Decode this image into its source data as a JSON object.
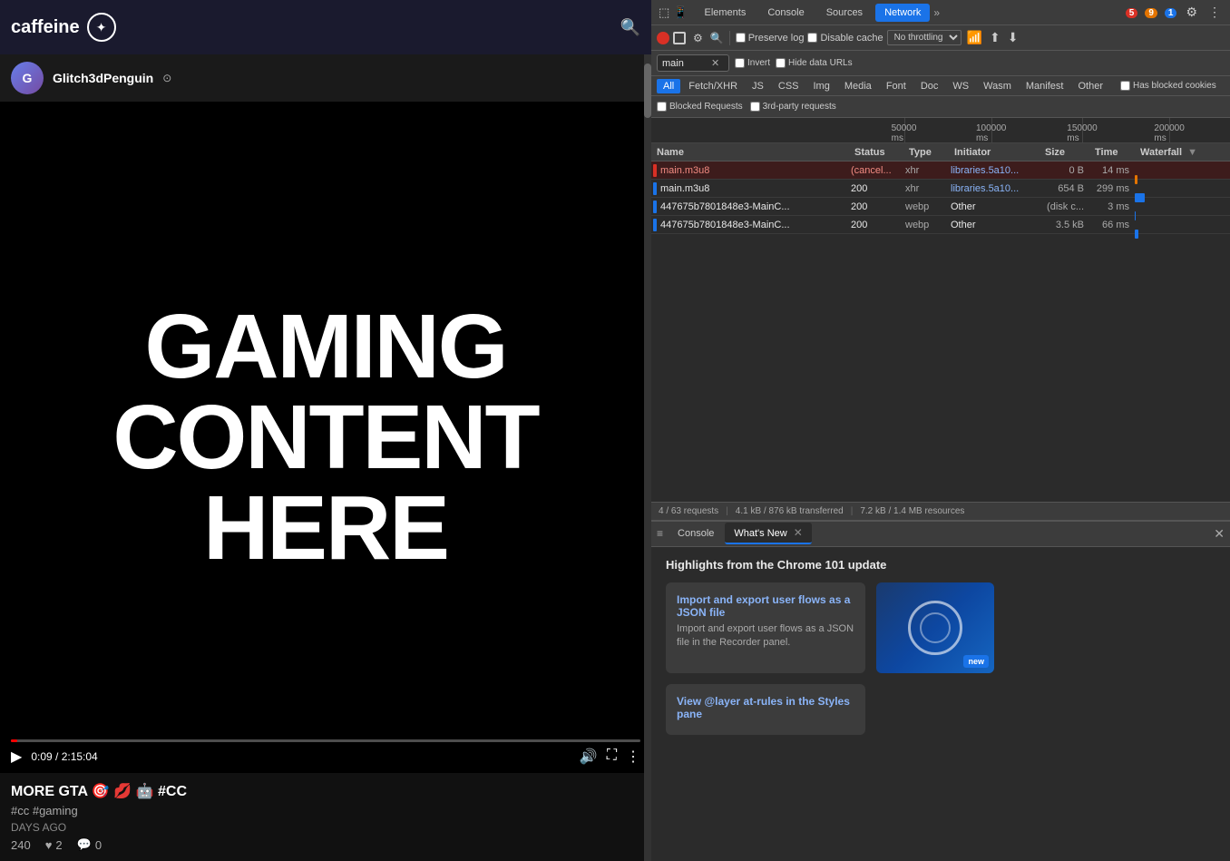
{
  "browser": {
    "logo_text": "caffeine",
    "logo_icon": "☆"
  },
  "video": {
    "title_line1": "GAMING",
    "title_line2": "CONTENT",
    "title_line3": "HERE",
    "current_time": "0:09",
    "total_time": "2:15:04",
    "progress_percent": 0.07,
    "channel_name": "Glitch3dPenguin",
    "video_title": "MORE GTA 🎯 💋 🤖 #CC",
    "video_tags": "#cc  #gaming",
    "days_ago": "DAYS AGO",
    "views": "240",
    "likes": "2",
    "comments": "0"
  },
  "devtools": {
    "tabs": [
      {
        "label": "Elements",
        "active": false
      },
      {
        "label": "Console",
        "active": false
      },
      {
        "label": "Sources",
        "active": false
      },
      {
        "label": "Network",
        "active": true
      }
    ],
    "error_count": "5",
    "warn_count": "9",
    "info_count": "1",
    "toolbar": {
      "record_btn": "record",
      "clear_btn": "clear",
      "filter_icon": "filter",
      "search_icon": "search",
      "preserve_log_label": "Preserve log",
      "preserve_log_checked": false,
      "disable_cache_label": "Disable cache",
      "disable_cache_checked": false,
      "throttle_value": "No throttling",
      "export_icon": "export",
      "import_icon": "import"
    },
    "filter_bar": {
      "input_value": "main",
      "invert_label": "Invert",
      "invert_checked": false,
      "hide_data_urls_label": "Hide data URLs",
      "hide_data_urls_checked": false
    },
    "filter_tabs": [
      {
        "label": "All",
        "active": true
      },
      {
        "label": "Fetch/XHR",
        "active": false
      },
      {
        "label": "JS",
        "active": false
      },
      {
        "label": "CSS",
        "active": false
      },
      {
        "label": "Img",
        "active": false
      },
      {
        "label": "Media",
        "active": false
      },
      {
        "label": "Font",
        "active": false
      },
      {
        "label": "Doc",
        "active": false
      },
      {
        "label": "WS",
        "active": false
      },
      {
        "label": "Wasm",
        "active": false
      },
      {
        "label": "Manifest",
        "active": false
      },
      {
        "label": "Other",
        "active": false
      }
    ],
    "has_blocked_cookies_label": "Has blocked cookies",
    "has_blocked_cookies_checked": false,
    "blocked_requests_label": "Blocked Requests",
    "blocked_requests_checked": false,
    "third_party_label": "3rd-party requests",
    "third_party_checked": false,
    "timeline": {
      "ticks": [
        {
          "ms": "50000 ms",
          "pos_pct": 14
        },
        {
          "ms": "100000 ms",
          "pos_pct": 37
        },
        {
          "ms": "150000 ms",
          "pos_pct": 61
        },
        {
          "ms": "200000 ms",
          "pos_pct": 84
        }
      ]
    },
    "table_headers": {
      "name": "Name",
      "status": "Status",
      "type": "Type",
      "initiator": "Initiator",
      "size": "Size",
      "time": "Time",
      "waterfall": "Waterfall"
    },
    "rows": [
      {
        "indicator": "red",
        "name": "main.m3u8",
        "status": "(cancel...",
        "status_class": "error",
        "type": "xhr",
        "initiator": "libraries.5a10...",
        "initiator_link": true,
        "size": "0 B",
        "time": "14 ms",
        "waterfall_pct": 2,
        "waterfall_width": 3,
        "error_row": true
      },
      {
        "indicator": "blue",
        "name": "main.m3u8",
        "status": "200",
        "status_class": "normal",
        "type": "xhr",
        "initiator": "libraries.5a10...",
        "initiator_link": true,
        "size": "654 B",
        "time": "299 ms",
        "waterfall_pct": 2,
        "waterfall_width": 10,
        "error_row": false
      },
      {
        "indicator": "blue",
        "name": "447675b7801848e3-MainC...",
        "status": "200",
        "status_class": "normal",
        "type": "webp",
        "initiator": "Other",
        "initiator_link": false,
        "size": "(disk c...",
        "time": "3 ms",
        "waterfall_pct": 2,
        "waterfall_width": 1,
        "error_row": false
      },
      {
        "indicator": "blue",
        "name": "447675b7801848e3-MainC...",
        "status": "200",
        "status_class": "normal",
        "type": "webp",
        "initiator": "Other",
        "initiator_link": false,
        "size": "3.5 kB",
        "time": "66 ms",
        "waterfall_pct": 2,
        "waterfall_width": 4,
        "error_row": false
      }
    ],
    "status_bar": {
      "requests": "4 / 63 requests",
      "transferred": "4.1 kB / 876 kB transferred",
      "resources": "7.2 kB / 1.4 MB resources"
    },
    "bottom_panel": {
      "tabs": [
        {
          "label": "Console",
          "active": false
        },
        {
          "label": "What's New",
          "active": true,
          "closable": true
        }
      ],
      "title": "Highlights from the Chrome 101 update",
      "update_items": [
        {
          "title": "Import and export user flows as a JSON file",
          "desc": "Import and export user flows as a JSON file in the Recorder panel."
        },
        {
          "title": "View @layer at-rules in the Styles pane",
          "desc": ""
        }
      ],
      "thumbnail_label": "new"
    }
  }
}
